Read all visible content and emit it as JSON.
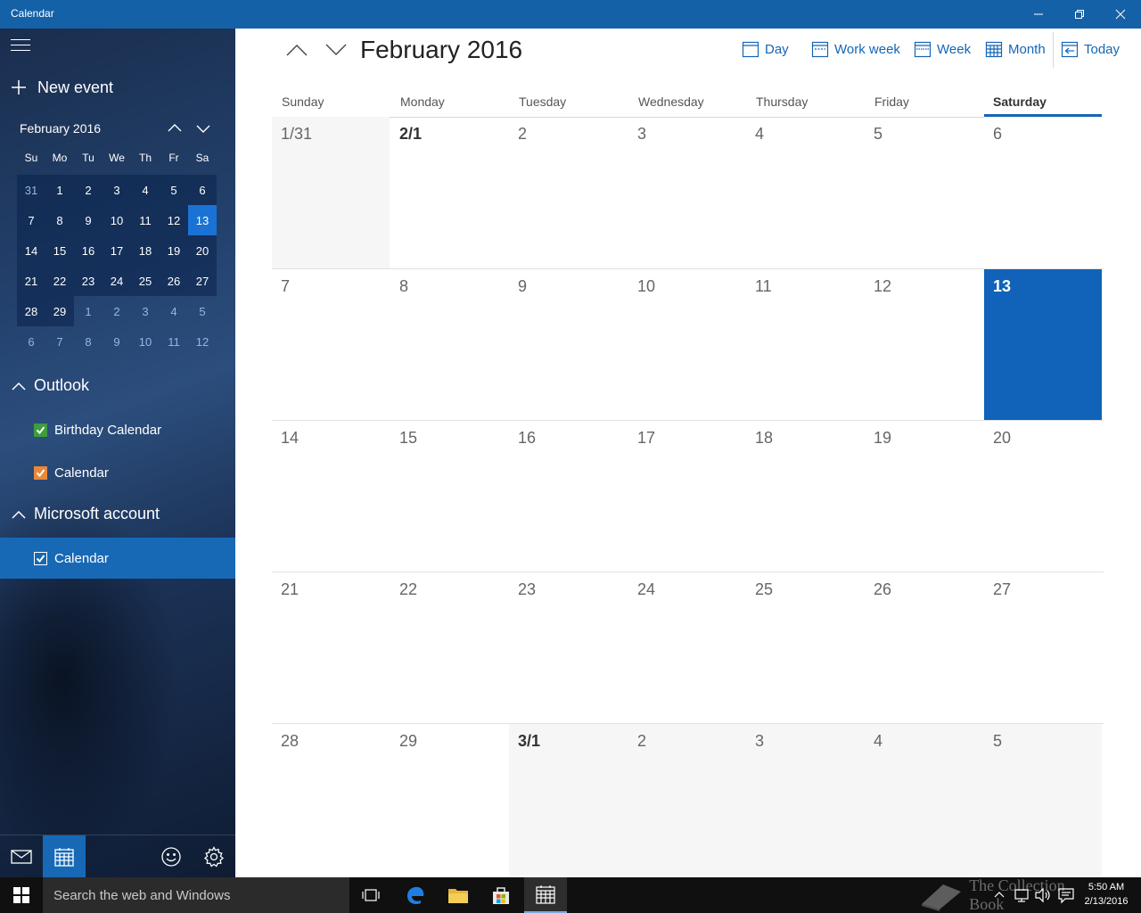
{
  "app": {
    "title": "Calendar"
  },
  "sidebar": {
    "new_event_label": "New event",
    "mini_calendar": {
      "month_label": "February 2016",
      "weekdays": [
        "Su",
        "Mo",
        "Tu",
        "We",
        "Th",
        "Fr",
        "Sa"
      ],
      "weeks": [
        [
          "31",
          "1",
          "2",
          "3",
          "4",
          "5",
          "6"
        ],
        [
          "7",
          "8",
          "9",
          "10",
          "11",
          "12",
          "13"
        ],
        [
          "14",
          "15",
          "16",
          "17",
          "18",
          "19",
          "20"
        ],
        [
          "21",
          "22",
          "23",
          "24",
          "25",
          "26",
          "27"
        ],
        [
          "28",
          "29",
          "1",
          "2",
          "3",
          "4",
          "5"
        ],
        [
          "6",
          "7",
          "8",
          "9",
          "10",
          "11",
          "12"
        ]
      ],
      "today": "13"
    },
    "groups": [
      {
        "label": "Outlook"
      },
      {
        "label": "Microsoft account"
      }
    ],
    "calendars": [
      {
        "label": "Birthday Calendar",
        "color": "#3c9e3c"
      },
      {
        "label": "Calendar",
        "color": "#e8893a"
      },
      {
        "label": "Calendar",
        "color": "#1769b6"
      }
    ]
  },
  "main": {
    "month_title": "February 2016",
    "views": [
      {
        "label": "Day",
        "icon": "calendar-day-icon"
      },
      {
        "label": "Work week",
        "icon": "calendar-workweek-icon"
      },
      {
        "label": "Week",
        "icon": "calendar-week-icon"
      },
      {
        "label": "Month",
        "icon": "calendar-month-icon"
      },
      {
        "label": "Today",
        "icon": "today-icon"
      }
    ],
    "weekday_headers": [
      "Sunday",
      "Monday",
      "Tuesday",
      "Wednesday",
      "Thursday",
      "Friday",
      "Saturday"
    ],
    "weeks": [
      [
        "1/31",
        "2/1",
        "2",
        "3",
        "4",
        "5",
        "6"
      ],
      [
        "7",
        "8",
        "9",
        "10",
        "11",
        "12",
        "13"
      ],
      [
        "14",
        "15",
        "16",
        "17",
        "18",
        "19",
        "20"
      ],
      [
        "21",
        "22",
        "23",
        "24",
        "25",
        "26",
        "27"
      ],
      [
        "28",
        "29",
        "3/1",
        "2",
        "3",
        "4",
        "5"
      ]
    ],
    "today": "13",
    "accent_color": "#1063b8"
  },
  "taskbar": {
    "search_placeholder": "Search the web and Windows",
    "time": "5:50 AM",
    "date": "2/13/2016",
    "watermark": "The Collection Book"
  }
}
